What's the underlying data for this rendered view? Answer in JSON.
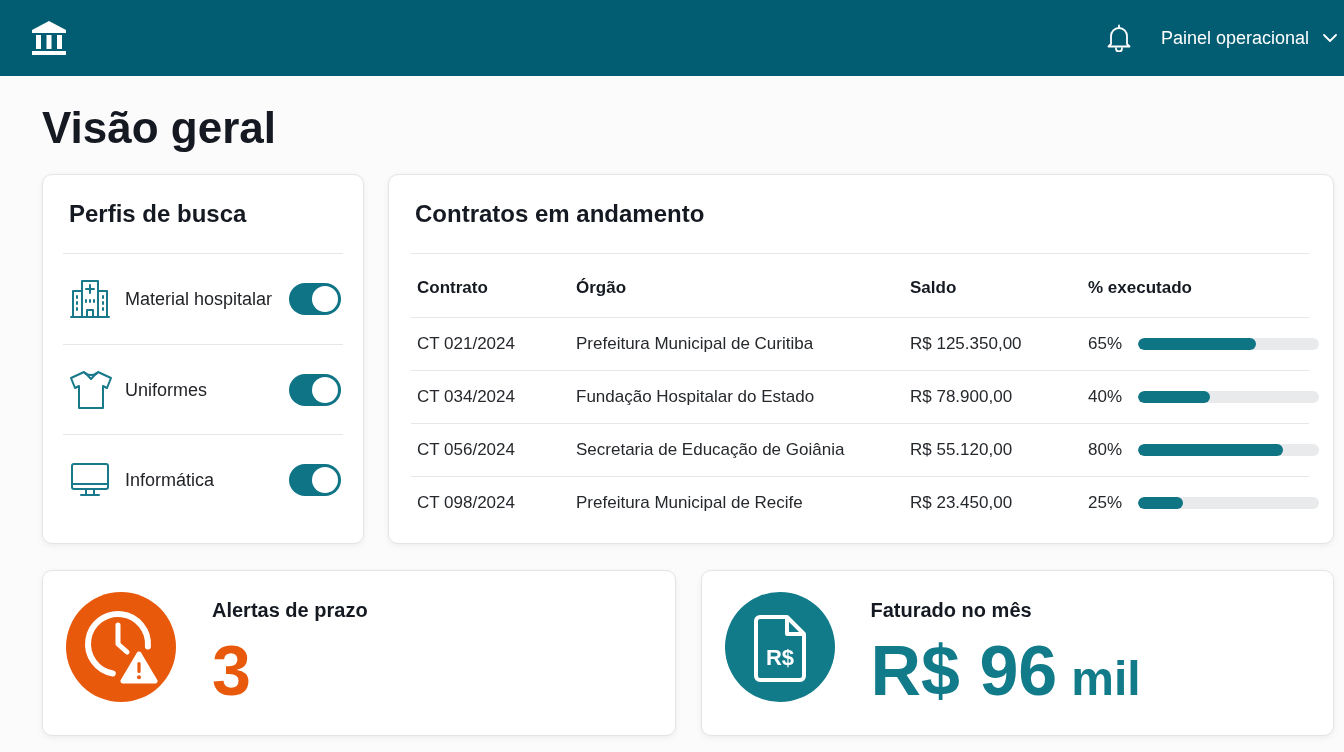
{
  "header": {
    "menu_label": "Painel operacional"
  },
  "page": {
    "title": "Visão geral"
  },
  "profiles": {
    "title": "Perfis de busca",
    "items": [
      {
        "label": "Material hospitalar",
        "on": true
      },
      {
        "label": "Uniformes",
        "on": true
      },
      {
        "label": "Informática",
        "on": true
      }
    ]
  },
  "contracts": {
    "title": "Contratos em andamento",
    "columns": [
      "Contrato",
      "Órgão",
      "Saldo",
      "% executado"
    ],
    "rows": [
      {
        "contract": "CT 021/2024",
        "agency": "Prefeitura Municipal de Curitiba",
        "balance": "R$ 125.350,00",
        "executed": "65%",
        "level": 0.65
      },
      {
        "contract": "CT 034/2024",
        "agency": "Fundação Hospitalar do Estado",
        "balance": "R$ 78.900,00",
        "executed": "40%",
        "level": 0.4
      },
      {
        "contract": "CT 056/2024",
        "agency": "Secretaria de Educação de Goiânia",
        "balance": "R$ 55.120,00",
        "executed": "80%",
        "level": 0.8
      },
      {
        "contract": "CT 098/2024",
        "agency": "Prefeitura Municipal de Recife",
        "balance": "R$ 23.450,00",
        "executed": "25%",
        "level": 0.25
      }
    ]
  },
  "stats": [
    {
      "label": "Alertas de prazo",
      "value": "3",
      "color": "#e8590c"
    },
    {
      "label": "Faturado no mês",
      "value": "R$ 96",
      "unit": "mil",
      "icon_text": "R$",
      "color": "#127b8a"
    }
  ]
}
